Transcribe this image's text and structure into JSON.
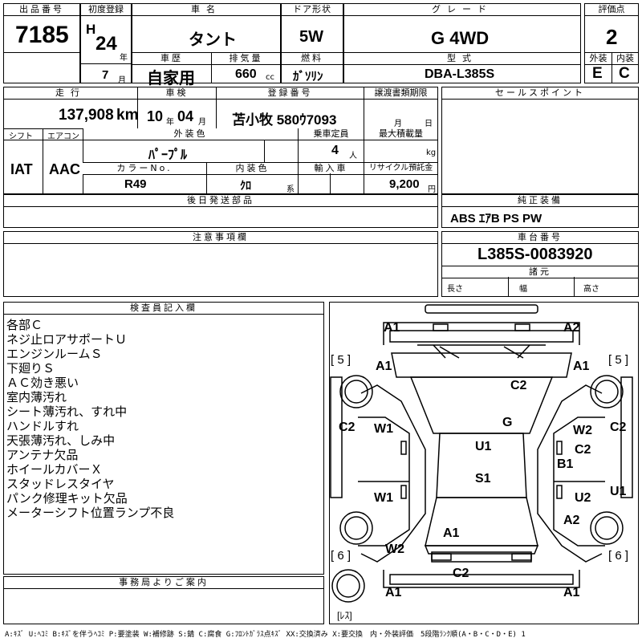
{
  "header": {
    "lot_no_label": "出品番号",
    "lot_no": "7185",
    "first_reg_label": "初度登録",
    "era": "H",
    "year": "24",
    "year_unit": "年",
    "month": "7",
    "month_unit": "月",
    "car_name_label": "車名",
    "car_name": "タント",
    "door_label": "ドア形状",
    "door": "5W",
    "grade_label": "グレード",
    "grade": "G 4WD",
    "score_label": "評価点",
    "score": "2",
    "history_label": "車歴",
    "history": "自家用",
    "displacement_label": "排気量",
    "displacement": "660",
    "displacement_unit": "cc",
    "fuel_label": "燃料",
    "fuel": "ｶﾞｿﾘﾝ",
    "model_label": "型式",
    "model": "DBA-L385S",
    "exterior_label": "外装",
    "exterior": "E",
    "interior_label": "内装",
    "interior": "C"
  },
  "row2": {
    "mileage_label": "走行",
    "mileage": "137,908",
    "mileage_unit": "km",
    "inspection_label": "車検",
    "insp_year": "10",
    "insp_year_unit": "年",
    "insp_month": "04",
    "insp_month_unit": "月",
    "plate_label": "登録番号",
    "plate": "苫小牧 580ｳ7093",
    "transfer_label": "譲渡書類期限",
    "transfer_month": "月",
    "transfer_day": "日",
    "sales_point_label": "セールスポイント",
    "shift_label": "シフト",
    "shift": "IAT",
    "ac_label": "エアコン",
    "ac": "AAC",
    "color_label": "外装色",
    "color": "ﾊﾟｰﾌﾟﾙ",
    "capacity_label": "乗車定員",
    "capacity": "4",
    "capacity_unit": "人",
    "load_label": "最大積載量",
    "load_unit": "kg",
    "color_no_label": "カラーNo.",
    "color_no": "R49",
    "int_color_label": "内装色",
    "int_color": "ｸﾛ",
    "int_color_unit": "系",
    "import_label": "輸入車",
    "recycle_label": "リサイクル預託金",
    "recycle": "9,200",
    "recycle_unit": "円"
  },
  "later_parts_label": "後日発送部品",
  "equipment_label": "純正装備",
  "equipment": "ABS ｴｱB PS PW",
  "notes_label": "注意事項欄",
  "chassis_label": "車台番号",
  "chassis": "L385S-0083920",
  "specs_label": "諸元",
  "length_label": "長さ",
  "width_label": "幅",
  "height_label": "高さ",
  "inspector_label": "検査員記入欄",
  "inspector_notes": [
    "各部Ｃ",
    "ネジ止ロアサポートＵ",
    "エンジンルームＳ",
    "下廻りＳ",
    "ＡＣ効き悪い",
    "室内薄汚れ",
    "シート薄汚れ、すれ中",
    "ハンドルすれ",
    "天張薄汚れ、しみ中",
    "アンテナ欠品",
    "ホイールカバーＸ",
    "スタッドレスタイヤ",
    "パンク修理キット欠品",
    "メーターシフト位置ランプ不良"
  ],
  "office_label": "事務局よりご案内",
  "diagram": {
    "tire_fl": "[ 5 ]",
    "tire_fr": "[ 5 ]",
    "tire_rl": "[ 6 ]",
    "tire_rr": "[ 6 ]",
    "spare": "[ﾚｽ]",
    "marks": [
      "A1",
      "A2",
      "A1",
      "A1",
      "C2",
      "G",
      "C2",
      "W1",
      "U1",
      "W2",
      "C2",
      "B1",
      "S1",
      "C2",
      "W1",
      "U2",
      "U1",
      "A2",
      "A1",
      "W2",
      "C2",
      "A1",
      "A1"
    ]
  },
  "legend": "A:ｷｽﾞ U:ﾍｺﾐ B:ｷｽﾞを伴うﾍｺﾐ P:要塗装 W:補修跡 S:錆 C:腐食 G:ﾌﾛﾝﾄｶﾞﾗｽ点ｷｽﾞ XX:交換済み X:要交換　内・外装評価　5段階ﾗﾝｸ順(A・B・C・D・E) 1"
}
